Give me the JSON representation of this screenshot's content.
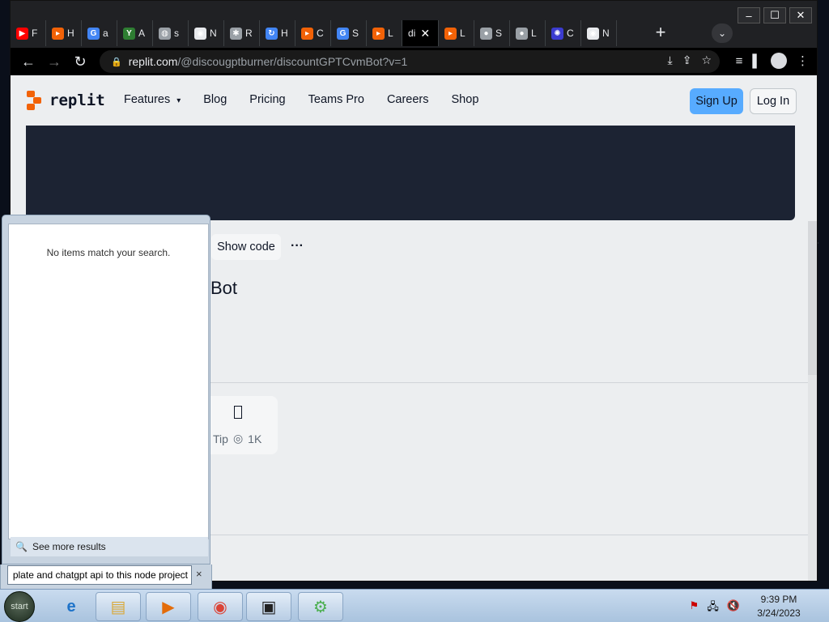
{
  "browser": {
    "tabs": [
      {
        "icon": "youtube-icon",
        "label": "F",
        "color": "#ff0000"
      },
      {
        "icon": "replit-icon",
        "label": "H",
        "color": "#f26207"
      },
      {
        "icon": "google-icon",
        "label": "a",
        "color": "#4285f4"
      },
      {
        "icon": "yandex-icon",
        "label": "A",
        "color": "#2e7d32"
      },
      {
        "icon": "globe-icon",
        "label": "s",
        "color": "#9aa0a6"
      },
      {
        "icon": "chrome-icon",
        "label": "N",
        "color": "#e8eaed"
      },
      {
        "icon": "puzzle-icon",
        "label": "R",
        "color": "#9aa0a6"
      },
      {
        "icon": "refresh-icon",
        "label": "H",
        "color": "#4285f4"
      },
      {
        "icon": "replit-icon",
        "label": "C",
        "color": "#f26207"
      },
      {
        "icon": "google-icon",
        "label": "S",
        "color": "#4285f4"
      },
      {
        "icon": "replit-icon",
        "label": "L",
        "color": "#f26207"
      },
      {
        "icon": "text-icon",
        "label": "di",
        "color": "#000000",
        "active": true
      },
      {
        "icon": "replit-icon",
        "label": "L",
        "color": "#f26207"
      },
      {
        "icon": "apple-icon",
        "label": "S",
        "color": "#9aa0a6"
      },
      {
        "icon": "apple-icon",
        "label": "L",
        "color": "#9aa0a6"
      },
      {
        "icon": "openai-icon",
        "label": "C",
        "color": "#3b3bcf"
      },
      {
        "icon": "chrome-icon",
        "label": "N",
        "color": "#e8eaed"
      }
    ],
    "new_tab_label": "+",
    "url_host": "replit.com",
    "url_path": "/@discougptburner/discountGPTCvmBot?v=1"
  },
  "site": {
    "logo_text": "replit",
    "nav": [
      "Features",
      "Blog",
      "Pricing",
      "Teams Pro",
      "Careers",
      "Shop"
    ],
    "signup_label": "Sign Up",
    "login_label": "Log In",
    "show_code_label": "Show code",
    "more_label": "···",
    "title_fragment": "Bot",
    "tip_label": "Tip",
    "tip_count": "1K",
    "colors": {
      "accent": "#f26207",
      "signup_bg": "#57abff",
      "banner": "#1c2333"
    }
  },
  "start_menu": {
    "no_results": "No items match your search.",
    "see_more": "See more results",
    "query": "plate and chatgpt api to this node project",
    "clear_label": "×"
  },
  "taskbar": {
    "start_label": "start",
    "time": "9:39 PM",
    "date": "3/24/2023"
  }
}
